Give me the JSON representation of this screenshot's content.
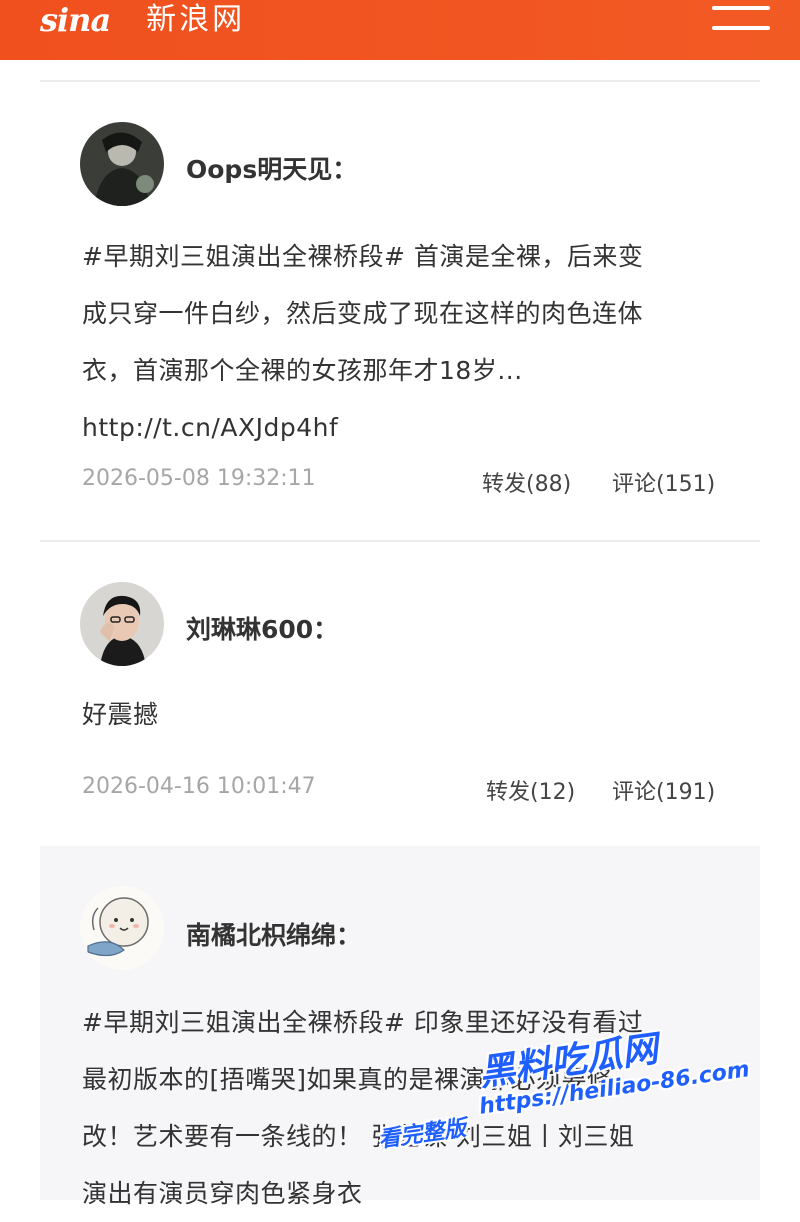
{
  "header": {
    "logo_mark": "sina",
    "logo_text": "新浪网",
    "menu_icon": "hamburger-menu-icon",
    "background": "#f0501e"
  },
  "comments": [
    {
      "avatar_icon": "dark-figure-avatar",
      "username": "Oops明天见：",
      "text_lines": [
        "#早期刘三姐演出全裸桥段# 首演是全裸，后来变",
        "成只穿一件白纱，然后变成了现在这样的肉色连体",
        "衣，首演那个全裸的女孩那年才18岁...",
        "http://t.cn/AXJdp4hf"
      ],
      "time": "2026-05-08 19:32:11",
      "repost": "转发(88)",
      "reply": "评论(151)"
    },
    {
      "avatar_icon": "man-portrait-avatar",
      "username": "刘琳琳600：",
      "text_lines": [
        "好震撼"
      ],
      "time": "2026-04-16 10:01:47",
      "repost": "转发(12)",
      "reply": "评论(191)"
    },
    {
      "avatar_icon": "cartoon-sheep-avatar",
      "username": "南橘北枳绵绵：",
      "text_lines": [
        "#早期刘三姐演出全裸桥段# 印象里还好没有看过",
        "最初版本的[捂嘴哭]如果真的是裸演那必须要修",
        "改！艺术要有一条线的！ 张艺谋 刘三姐丨刘三姐",
        "演出有演员穿肉色紧身衣"
      ]
    }
  ],
  "watermark": {
    "title": "黑料吃瓜网",
    "url": "https://heiliao-86.com",
    "cta": "看完整版",
    "color": "#1f5fff"
  }
}
